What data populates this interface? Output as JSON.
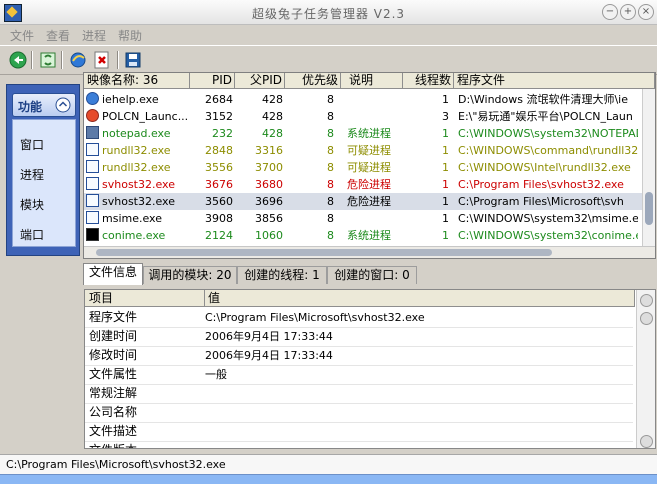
{
  "window": {
    "title": "超级兔子任务管理器  V2.3",
    "minimize_icon": "minimize-icon",
    "maximize_icon": "maximize-icon",
    "close_icon": "close-icon"
  },
  "menu": [
    "文件",
    "查看",
    "进程",
    "帮助"
  ],
  "toolbar": {
    "refresh_icon": "refresh-icon",
    "reload_icon": "reload-icon",
    "ie_icon": "ie-icon",
    "terminate_icon": "terminate-icon",
    "save_icon": "save-icon"
  },
  "sidebar": {
    "title": "功能",
    "items": [
      "窗口",
      "进程",
      "模块",
      "端口"
    ]
  },
  "process_table": {
    "headers": [
      "映像名称: 36",
      "PID",
      "父PID",
      "优先级",
      "说明",
      "线程数",
      "程序文件"
    ],
    "rows": [
      {
        "name": "iehelp.exe",
        "pid": "2684",
        "ppid": "428",
        "priority": "8",
        "desc": "",
        "threads": "1",
        "path": "D:\\Windows 流氓软件清理大师\\ie",
        "icon": "iehelp-icon",
        "tone": "black"
      },
      {
        "name": "POLCN_Launc...",
        "pid": "3152",
        "ppid": "428",
        "priority": "8",
        "desc": "",
        "threads": "3",
        "path": "E:\\\"易玩通\"娱乐平台\\POLCN_Laun",
        "icon": "polcn-icon",
        "tone": "black"
      },
      {
        "name": "notepad.exe",
        "pid": "232",
        "ppid": "428",
        "priority": "8",
        "desc": "系统进程",
        "threads": "1",
        "path": "C:\\WINDOWS\\system32\\NOTEPAD.EX",
        "icon": "notepad-icon",
        "tone": "green"
      },
      {
        "name": "rundll32.exe",
        "pid": "2848",
        "ppid": "3316",
        "priority": "8",
        "desc": "可疑进程",
        "threads": "1",
        "path": "C:\\WINDOWS\\command\\rundll32.exe",
        "icon": "rundll32-icon",
        "tone": "orange"
      },
      {
        "name": "rundll32.exe",
        "pid": "3556",
        "ppid": "3700",
        "priority": "8",
        "desc": "可疑进程",
        "threads": "1",
        "path": "C:\\WINDOWS\\Intel\\rundll32.exe",
        "icon": "rundll32-icon",
        "tone": "orange"
      },
      {
        "name": "svhost32.exe",
        "pid": "3676",
        "ppid": "3680",
        "priority": "8",
        "desc": "危险进程",
        "threads": "1",
        "path": "C:\\Program Files\\svhost32.exe",
        "icon": "svhost32-icon",
        "tone": "red"
      },
      {
        "name": "svhost32.exe",
        "pid": "3560",
        "ppid": "3696",
        "priority": "8",
        "desc": "危险进程",
        "threads": "1",
        "path": "C:\\Program Files\\Microsoft\\svh",
        "icon": "svhost32-icon",
        "tone": "black",
        "selected": true
      },
      {
        "name": "msime.exe",
        "pid": "3908",
        "ppid": "3856",
        "priority": "8",
        "desc": "",
        "threads": "1",
        "path": "C:\\WINDOWS\\system32\\msime.exe",
        "icon": "msime-icon",
        "tone": "black"
      },
      {
        "name": "conime.exe",
        "pid": "2124",
        "ppid": "1060",
        "priority": "8",
        "desc": "系统进程",
        "threads": "1",
        "path": "C:\\WINDOWS\\system32\\conime.exe",
        "icon": "conime-icon",
        "tone": "green"
      }
    ]
  },
  "tabs": [
    "文件信息",
    "调用的模块: 20",
    "创建的线程: 1",
    "创建的窗口: 0"
  ],
  "details": {
    "headers": [
      "项目",
      "值"
    ],
    "rows": [
      {
        "key": "程序文件",
        "value": "C:\\Program Files\\Microsoft\\svhost32.exe"
      },
      {
        "key": "创建时间",
        "value": "2006年9月4日   17:33:44"
      },
      {
        "key": "修改时间",
        "value": "2006年9月4日   17:33:44"
      },
      {
        "key": "文件属性",
        "value": "一般"
      },
      {
        "key": "常规注解",
        "value": ""
      },
      {
        "key": "公司名称",
        "value": ""
      },
      {
        "key": "文件描述",
        "value": ""
      },
      {
        "key": "文件版本",
        "value": ""
      }
    ]
  },
  "status": {
    "text": "C:\\Program Files\\Microsoft\\svhost32.exe"
  },
  "colors": {
    "system": "#1c8a1c",
    "suspicious": "#8d8d00",
    "danger": "#cc0000",
    "sidebar": "#3e63b7"
  }
}
